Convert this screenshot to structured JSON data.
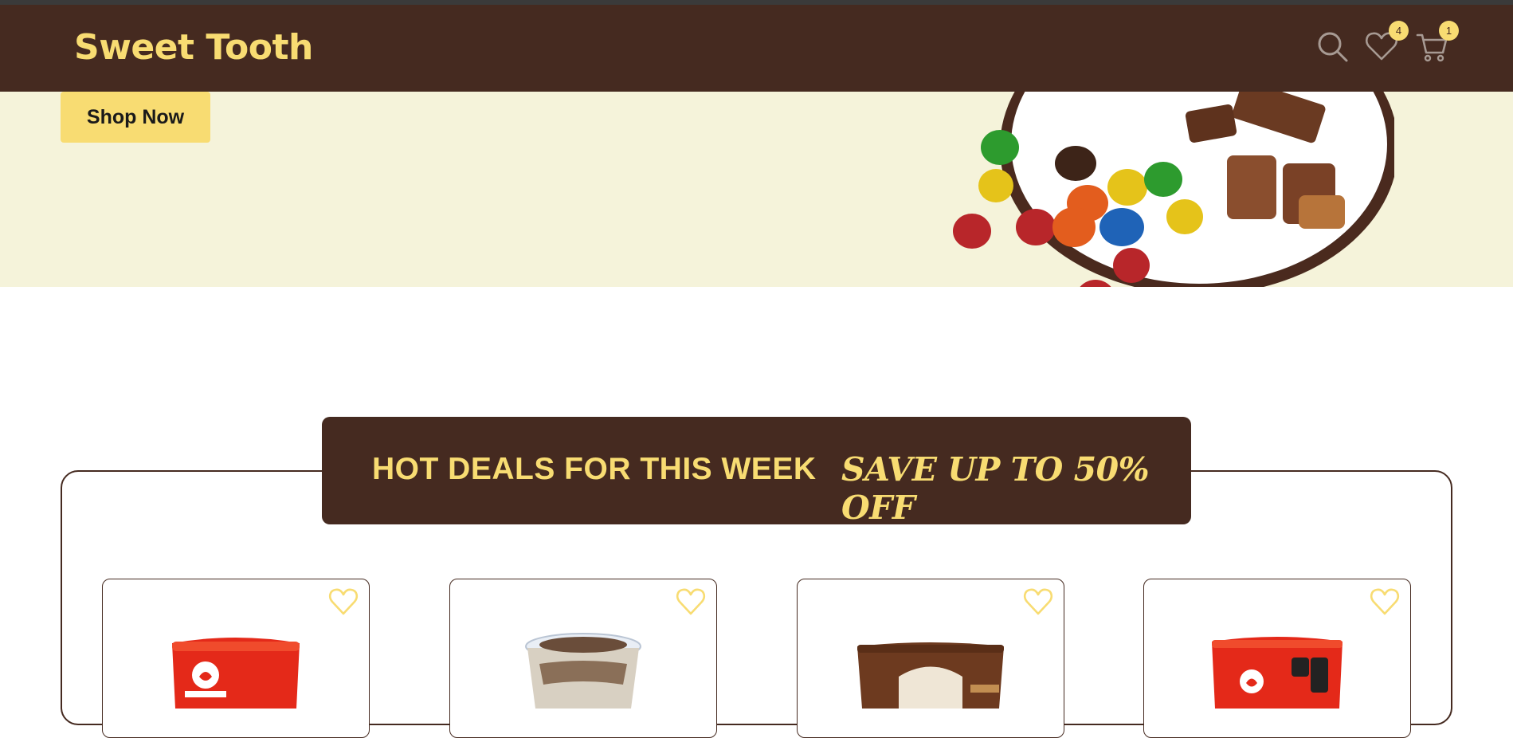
{
  "brand": {
    "name": "Sweet Tooth"
  },
  "header": {
    "icons": [
      "search-icon",
      "heart-icon",
      "cart-icon"
    ],
    "wishlist_count": "4",
    "cart_count": "1"
  },
  "hero": {
    "shop_button": "Shop Now"
  },
  "deals": {
    "title": "HOT DEALS FOR THIS WEEK",
    "subtitle": "SAVE UP TO 50% OFF"
  },
  "products": [
    {
      "image": "holanda-ice-cream-tub"
    },
    {
      "image": "white-ice-cream-tub"
    },
    {
      "image": "chocolate-ice-cream-tub"
    },
    {
      "image": "holanda-ice-cream-tub"
    }
  ],
  "colors": {
    "brown": "#452a20",
    "yellow": "#f8dc72",
    "cream": "#f5f3da"
  }
}
